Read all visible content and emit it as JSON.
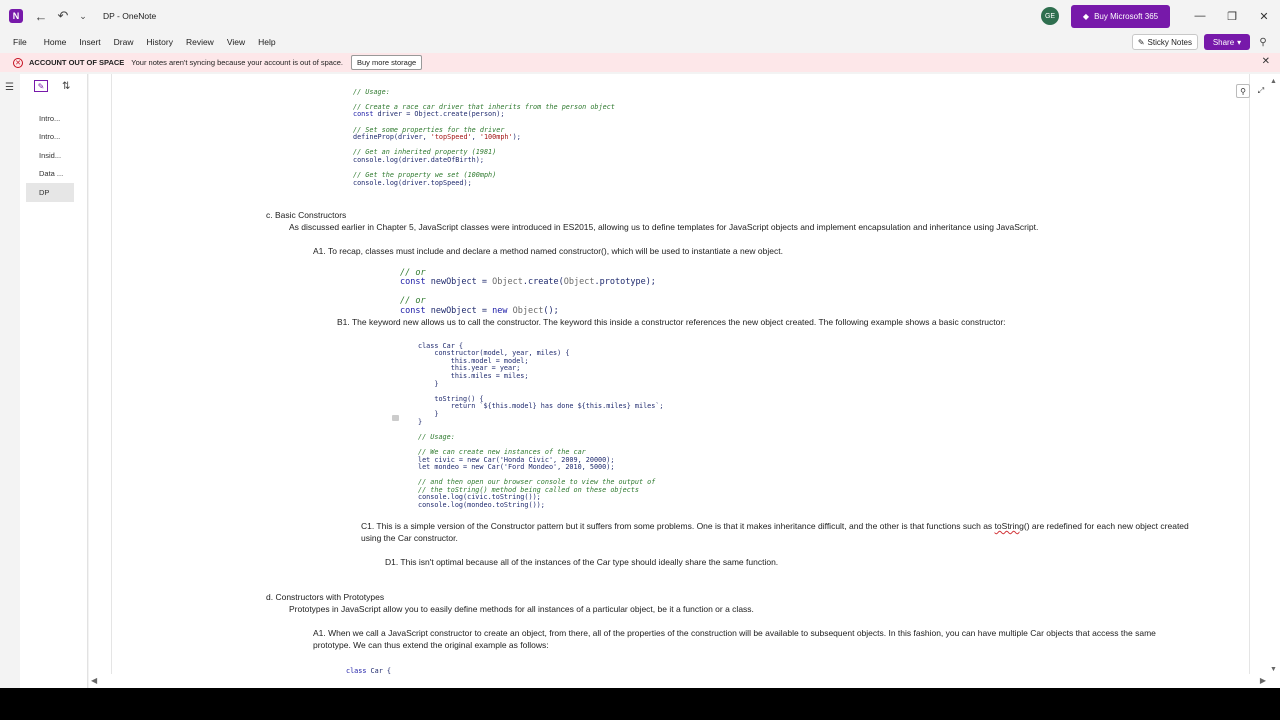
{
  "window": {
    "title": "DP - OneNote",
    "avatar_initials": "GE",
    "buy_label": "Buy Microsoft 365"
  },
  "menu": {
    "items": [
      "File",
      "Home",
      "Insert",
      "Draw",
      "History",
      "Review",
      "View",
      "Help"
    ],
    "sticky_notes": "Sticky Notes",
    "share": "Share"
  },
  "warning": {
    "title": "ACCOUNT OUT OF SPACE",
    "message": "Your notes aren't syncing because your account is out of space.",
    "button": "Buy more storage"
  },
  "pages": [
    "Intro...",
    "Intro...",
    "Insid...",
    "Data ...",
    "DP"
  ],
  "active_page": "DP",
  "note": {
    "code1": {
      "c1": "// Usage:",
      "c2": "// Create a race car driver that inherits from the person object",
      "l2_kw": "const",
      "l2_rest": " driver = Object.create(person);",
      "c3": "// Set some properties for the driver",
      "l3a": "defineProp(driver, ",
      "l3s1": "'topSpeed'",
      "l3m": ", ",
      "l3s2": "'100mph'",
      "l3e": ");",
      "c4": "// Get an inherited property (1981)",
      "l4": "console.log(driver.dateOfBirth);",
      "c5": "// Get the property we set (100mph)",
      "l5": "console.log(driver.topSpeed);"
    },
    "c_heading": "c. Basic Constructors",
    "c_intro": "As discussed earlier in Chapter 5, JavaScript classes were introduced in ES2015, allowing us to define templates for JavaScript objects and implement encapsulation and inheritance using JavaScript.",
    "a1": "A1. To recap, classes must include and declare a method named constructor(), which will be used to instantiate a new object.",
    "code2": {
      "or1": "// or",
      "kw": "const",
      "v1a": " newObject = ",
      "v1b": "Object",
      "v1c": ".create(",
      "v1d": "Object",
      "v1e": ".prototype);",
      "or2": "// or",
      "v2a": " newObject = ",
      "v2b": "new",
      "v2c": " ",
      "v2d": "Object",
      "v2e": "();"
    },
    "b1": "B1. The keyword new allows us to call the constructor. The keyword this inside a constructor references the new object created. The following example shows a basic constructor:",
    "code3": {
      "l1": "class Car {",
      "l2": "    constructor(model, year, miles) {",
      "l3": "        this.model = model;",
      "l4": "        this.year = year;",
      "l5": "        this.miles = miles;",
      "l6": "    }",
      "l7": "    toString() {",
      "l8": "        return `${this.model} has done ${this.miles} miles`;",
      "l9": "    }",
      "l10": "}",
      "c1": "// Usage:",
      "c2": "// We can create new instances of the car",
      "l11": "let civic = new Car('Honda Civic', 2009, 20000);",
      "l12": "let mondeo = new Car('Ford Mondeo', 2010, 5000);",
      "c3": "// and then open our browser console to view the output of",
      "c4": "// the toString() method being called on these objects",
      "l13": "console.log(civic.toString());",
      "l14": "console.log(mondeo.toString());"
    },
    "c1_pre": "C1. This is a simple version of the Constructor pattern but it suffers from some problems. One is that it makes inheritance difficult, and the other is that functions such as ",
    "c1_spell": "toString",
    "c1_post": "() are redefined for each new object created",
    "c1_line2": "using the Car constructor.",
    "d1": "D1. This isn't optimal because all of the instances of the Car type should ideally share the same function.",
    "d_heading": "d. Constructors with Prototypes",
    "d_intro": "Prototypes in JavaScript allow you to easily define methods for all instances of a particular object, be it a function or a class.",
    "d_a1_line1": "A1. When we call a JavaScript constructor to create an object, from there, all of the properties of the construction will be available to subsequent objects. In this fashion, you can have multiple Car objects that access the same",
    "d_a1_line2": "prototype. We can thus extend the original example as follows:",
    "code4_kw": "class",
    "code4_rest": " Car {"
  },
  "icons": {
    "back": "back-arrow-icon",
    "undo": "undo-icon",
    "search": "search-icon",
    "expand": "expand-icon"
  }
}
